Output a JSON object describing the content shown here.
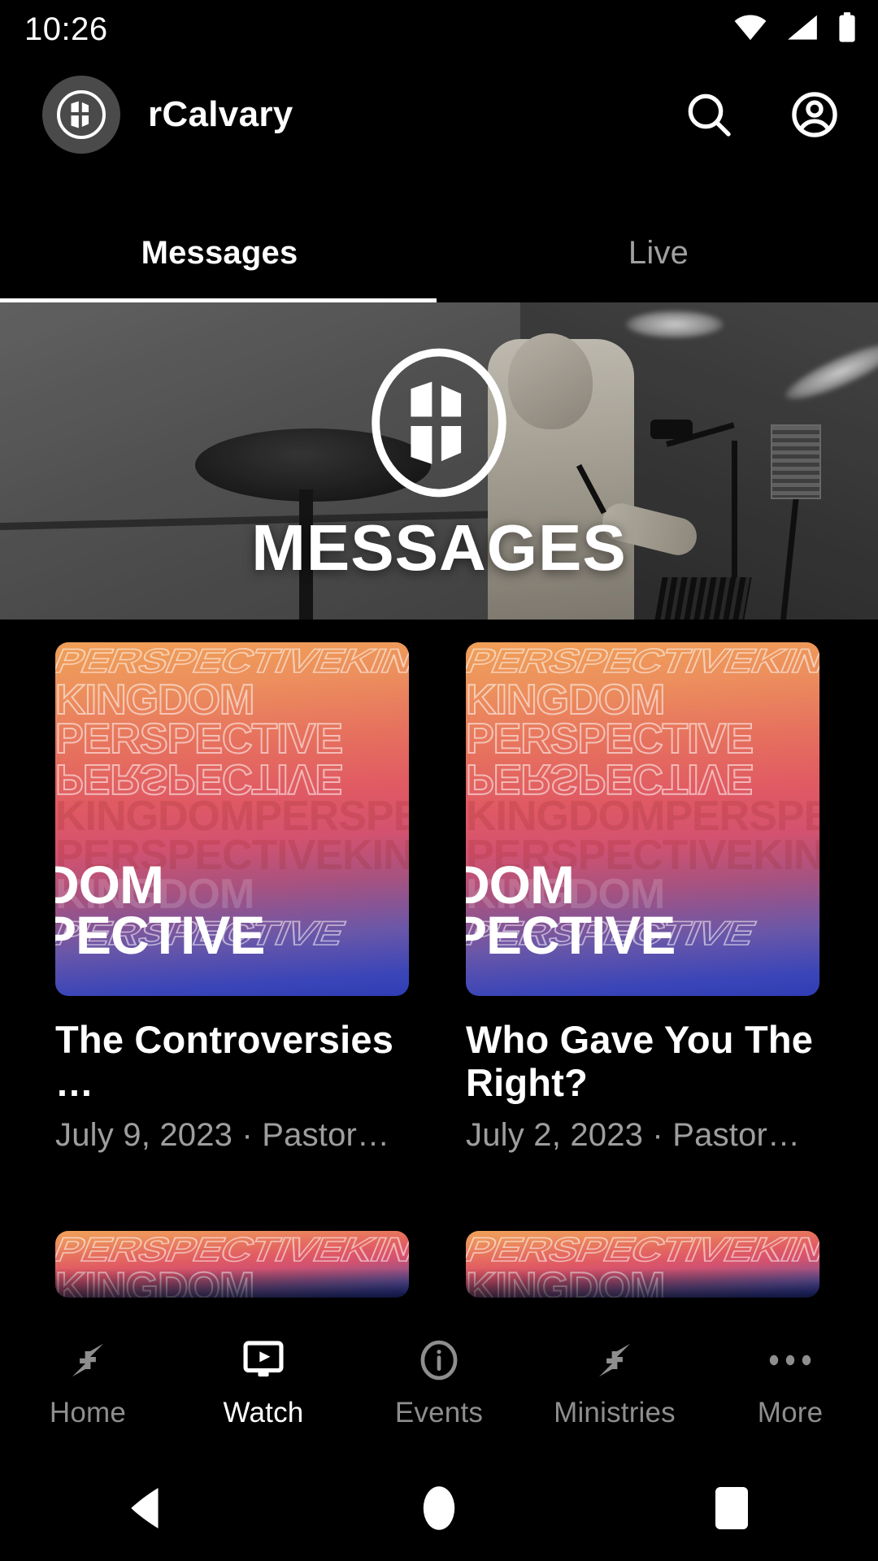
{
  "status_bar": {
    "clock": "10:26",
    "icons": [
      "wifi-icon",
      "cellular-signal-icon",
      "battery-icon"
    ]
  },
  "app_bar": {
    "logo_icon": "church-cross-logo-icon",
    "title": "rCalvary",
    "search_icon": "search-icon",
    "account_icon": "account-circle-icon"
  },
  "tabs": {
    "items": [
      {
        "label": "Messages",
        "active": true
      },
      {
        "label": "Live",
        "active": false
      }
    ]
  },
  "hero": {
    "overlay_title": "MESSAGES",
    "logo_icon": "church-cross-logo-icon",
    "description": "Grayscale photo of a pastor speaking with a microphone on stage"
  },
  "sermons": [
    {
      "artwork_series": "KINGDOM PERSPECTIVE",
      "artwork_line1": "DOM",
      "artwork_line2": "PECTIVE",
      "title": "The Controversies …",
      "meta": "July 9, 2023 · Pastor…"
    },
    {
      "artwork_series": "KINGDOM PERSPECTIVE",
      "artwork_line1": "DOM",
      "artwork_line2": "PECTIVE",
      "title": "Who Gave You The Right?",
      "meta": "July 2, 2023 · Pastor…"
    }
  ],
  "artwork_text": {
    "row_kingdom": "KINGDOM",
    "row_perspective": "PERSPECTIVE",
    "row_mixed": "PERSPECTIVEKINGDOM",
    "row_mixed2": "KINGDOMPERSPECTIVE"
  },
  "bottom_nav": {
    "items": [
      {
        "label": "Home",
        "icon": "collapse-arrows-icon",
        "active": false
      },
      {
        "label": "Watch",
        "icon": "monitor-play-icon",
        "active": true
      },
      {
        "label": "Events",
        "icon": "info-circle-icon",
        "active": false
      },
      {
        "label": "Ministries",
        "icon": "collapse-arrows-icon",
        "active": false
      },
      {
        "label": "More",
        "icon": "more-horizontal-icon",
        "active": false
      }
    ]
  },
  "system_nav": {
    "back_icon": "back-triangle-icon",
    "home_icon": "home-circle-icon",
    "recents_icon": "recents-square-icon"
  },
  "colors": {
    "background": "#000000",
    "accent_white": "#ffffff",
    "muted_text": "#9e9e9e",
    "logo_circle": "#4a4a4a",
    "artwork_orange": "#f0a058",
    "artwork_red": "#e05a63",
    "artwork_blue": "#2f3db4"
  }
}
